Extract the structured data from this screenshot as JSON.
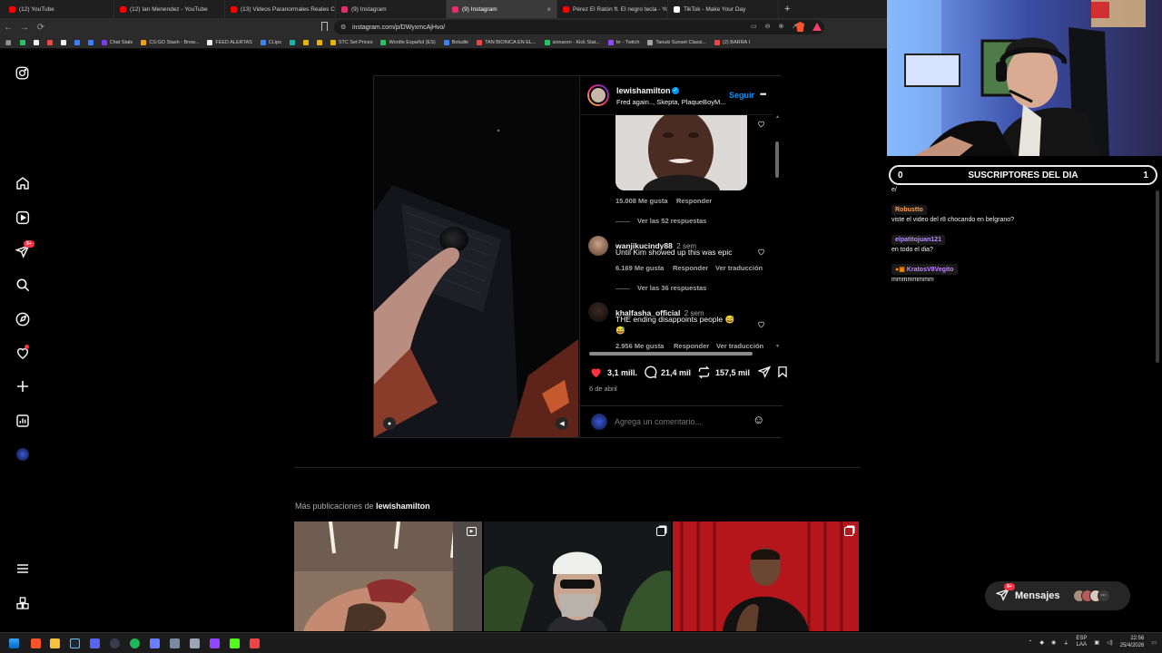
{
  "browser": {
    "tabs": [
      {
        "title": "(12) YouTube",
        "color": "#ff0000"
      },
      {
        "title": "(12) Ian Menendez - YouTube",
        "color": "#ff0000"
      },
      {
        "title": "(13) Videos Paranormales Reales Co...",
        "color": "#ff0000"
      },
      {
        "title": "(9) Instagram",
        "color": "#e1306c"
      },
      {
        "title": "(9) Instagram",
        "color": "#e1306c",
        "active": true
      },
      {
        "title": "Pérez El Ratón ft. El negro tecla - Yo...",
        "color": "#ff0000"
      },
      {
        "title": "TikTok - Make Your Day",
        "color": "#ffffff"
      }
    ],
    "new_tab_symbol": "+",
    "url": "instagram.com/p/DWyxmcAjHvo/",
    "bookmarks": [
      {
        "label": "",
        "color": "#22c55e"
      },
      {
        "label": "",
        "color": "#eeeeee"
      },
      {
        "label": "",
        "color": "#ef4444"
      },
      {
        "label": "",
        "color": "#eeeeee"
      },
      {
        "label": "",
        "color": "#3b82f6"
      },
      {
        "label": "",
        "color": "#3b82f6"
      },
      {
        "label": "Chat Stats",
        "color": "#7c3aed"
      },
      {
        "label": "CS:GO Stash - Brow...",
        "color": "#f59e0b"
      },
      {
        "label": "FEED ALERTAS",
        "color": "#eeeeee"
      },
      {
        "label": "CLips",
        "color": "#3b82f6"
      },
      {
        "label": "",
        "color": "#14b8a6"
      },
      {
        "label": "",
        "color": "#eab308"
      },
      {
        "label": "",
        "color": "#eab308"
      },
      {
        "label": "STC Set Prices",
        "color": "#eab308"
      },
      {
        "label": "Wordle Español (ES)",
        "color": "#22c55e"
      },
      {
        "label": "Boludle",
        "color": "#3b82f6"
      },
      {
        "label": "TAN BIONICA EN EL...",
        "color": "#ef4444"
      },
      {
        "label": "sionaron - Kick Stat...",
        "color": "#22c55e"
      },
      {
        "label": "trr - Twitch",
        "color": "#9146ff"
      },
      {
        "label": "Tanuki Sunset Classi...",
        "color": "#a3a3a3"
      },
      {
        "label": "(2) BARRA I",
        "color": "#ef4444"
      }
    ]
  },
  "sidebar": {
    "notifications_badge": "9+"
  },
  "post": {
    "author": "lewishamilton",
    "verified": true,
    "audio": "Fred again.., Skepta, PlaqueBoyM...",
    "follow_label": "Seguir",
    "more_symbol": "•••",
    "comments": [
      {
        "likes": "15.008 Me gusta",
        "reply": "Responder",
        "replies": "Ver las 52 respuestas"
      },
      {
        "user": "wanjikucindy88",
        "age": "2 sem",
        "text": "Until Kim showed up this was epic",
        "likes": "6.169 Me gusta",
        "reply": "Responder",
        "translate": "Ver traducción",
        "replies": "Ver las 36 respuestas"
      },
      {
        "user": "khalfasha_official",
        "age": "2 sem",
        "text": "THE ending disappoints people 😅",
        "text2": "😅",
        "likes": "2.956 Me gusta",
        "reply": "Responder",
        "translate": "Ver traducción"
      }
    ],
    "like_count": "3,1 mill.",
    "comment_count": "21,4 mil",
    "repost_count": "157,5 mil",
    "date": "6 de abril",
    "comment_placeholder": "Agrega un comentario...",
    "emoji_symbol": "☺"
  },
  "more": {
    "prefix": "Más publicaciones de ",
    "author": "lewishamilton"
  },
  "stream": {
    "subs_left": "0",
    "subs_title": "SUSCRIPTORES DEL DIA",
    "subs_right": "1",
    "chat": [
      {
        "partial": "e/"
      },
      {
        "name": "Robustto",
        "color": "#ff9e4f",
        "msg": "viste el video del r8 chocando en belgrano?"
      },
      {
        "name": "elpatitojuan121",
        "color": "#b98bff",
        "msg": "en todo el dia?"
      },
      {
        "name": "KratosV8Vegito",
        "color": "#c082ff",
        "msg": "mmmmmmmm"
      }
    ]
  },
  "messages": {
    "label": "Mensajes",
    "badge": "9+"
  },
  "taskbar": {
    "lang_top": "ESP",
    "lang_bottom": "LAA",
    "time": "22:56",
    "date": "25/4/2026"
  }
}
